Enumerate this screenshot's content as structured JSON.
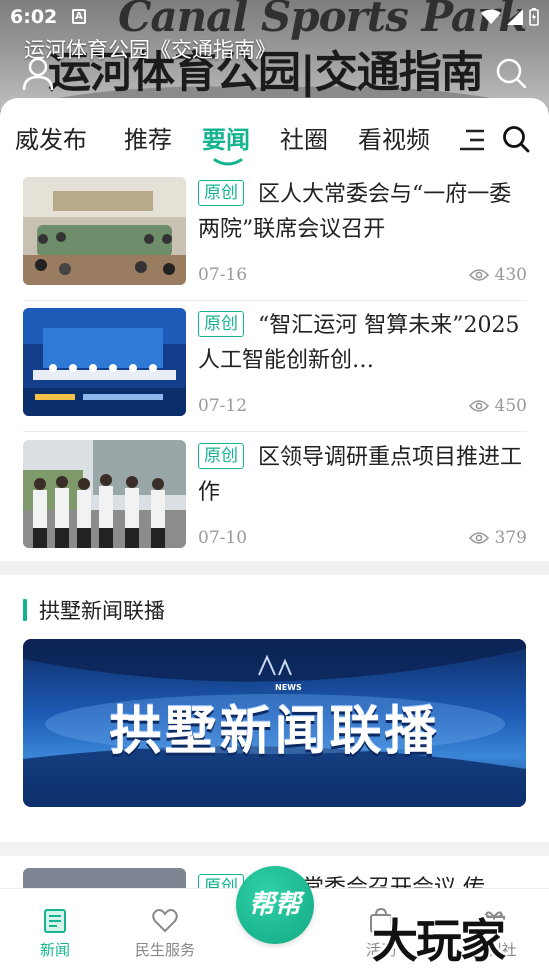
{
  "status_bar": {
    "time": "6:02",
    "notification_letter": "A"
  },
  "hero": {
    "brand": "Canal Sports Park",
    "big_title": "运河体育公园|交通指南",
    "caption": "运河体育公园《交通指南》"
  },
  "tabs": [
    {
      "label": "威发布"
    },
    {
      "label": "推荐"
    },
    {
      "label": "要闻",
      "active": true
    },
    {
      "label": "社圈"
    },
    {
      "label": "看视频"
    }
  ],
  "news": [
    {
      "badge": "原创",
      "title": "区人大常委会与“一府一委两院”联席会议召开",
      "date": "07-16",
      "views": "430"
    },
    {
      "badge": "原创",
      "title": "“智汇运河 智算未来”2025人工智能创新创…",
      "date": "07-12",
      "views": "450"
    },
    {
      "badge": "原创",
      "title": "区领导调研重点项目推进工作",
      "date": "07-10",
      "views": "379"
    }
  ],
  "section": {
    "title": "拱墅新闻联播"
  },
  "banner": {
    "text": "拱墅新闻联播",
    "small_label": "NEWS"
  },
  "peek_item": {
    "badge": "原创",
    "title": "区委常委会召开会议 传"
  },
  "bottom_nav": {
    "items": [
      {
        "label": "新闻",
        "icon": "newspaper-icon",
        "active": true
      },
      {
        "label": "民生服务",
        "icon": "heart-icon"
      },
      {
        "label": "活动",
        "icon": "bag-icon"
      },
      {
        "label": "福利社",
        "icon": "gift-icon"
      }
    ],
    "center_label": "帮帮"
  },
  "watermark": "大玩家",
  "colors": {
    "accent": "#14b491",
    "muted": "#999999",
    "banner_blue": "#1d5bb5"
  }
}
